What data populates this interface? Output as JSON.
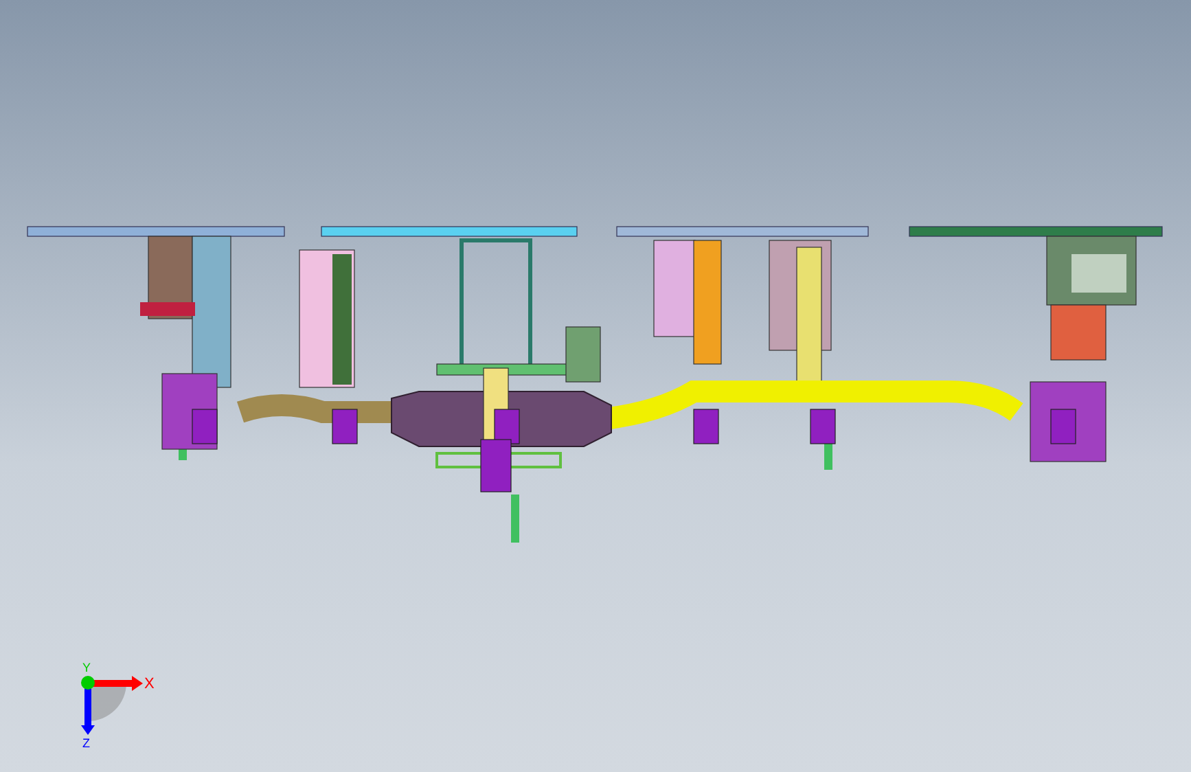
{
  "viewport": {
    "axes": [
      {
        "kind": "horizontal",
        "label": "X"
      },
      {
        "kind": "toward",
        "label": "Y"
      },
      {
        "kind": "vertical",
        "label": "Z"
      }
    ]
  }
}
